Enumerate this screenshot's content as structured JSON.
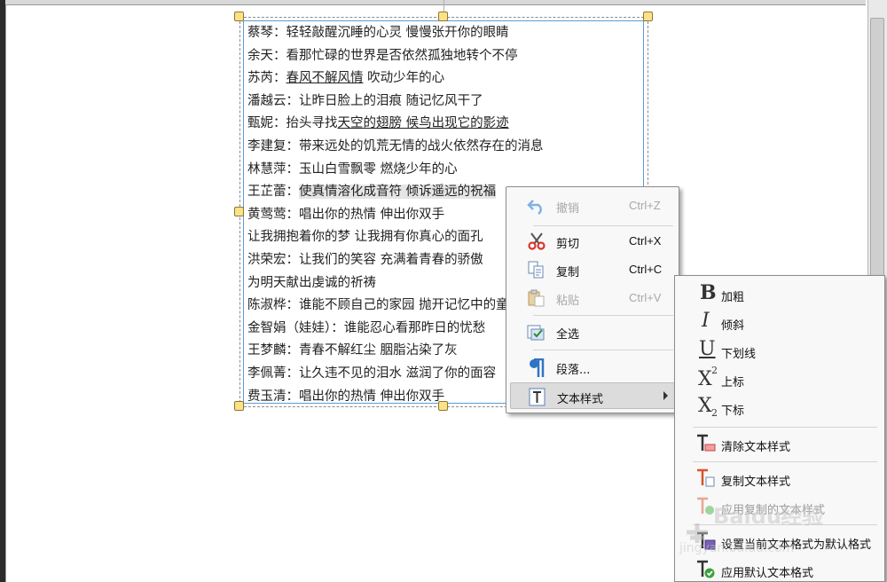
{
  "document": {
    "lines": [
      {
        "parts": [
          {
            "t": "蔡琴：轻轻敲醒沉睡的心灵 慢慢张开你的眼睛"
          }
        ]
      },
      {
        "parts": [
          {
            "t": "余天：看那忙碌的世界是否依然孤独地转个不停"
          }
        ]
      },
      {
        "parts": [
          {
            "t": "苏芮："
          },
          {
            "t": "春风不解风情",
            "u": true
          },
          {
            "t": " 吹动少年的心"
          }
        ]
      },
      {
        "parts": [
          {
            "t": "潘越云：让昨日脸上的泪痕 随记忆风干了"
          }
        ]
      },
      {
        "parts": [
          {
            "t": "甄妮：抬头寻找"
          },
          {
            "t": "天空的翅膀 候鸟出现它的影迹",
            "u": true
          }
        ]
      },
      {
        "parts": [
          {
            "t": "李建复：带来远处的饥荒无情的战火依然存在的消息"
          }
        ]
      },
      {
        "parts": [
          {
            "t": "林慧萍：玉山白雪飘零 燃烧少年的心"
          }
        ]
      },
      {
        "parts": [
          {
            "t": "王芷蕾："
          },
          {
            "t": "使真情溶化成音符 倾诉遥远的祝福",
            "hl": true
          }
        ]
      },
      {
        "parts": [
          {
            "t": "黄莺莺：唱出你的热情 伸出你双手"
          }
        ]
      },
      {
        "parts": [
          {
            "t": "让我拥抱着你的梦 让我拥有你真心的面孔"
          }
        ]
      },
      {
        "parts": [
          {
            "t": "洪荣宏：让我们的笑容 充满着青春的骄傲"
          }
        ]
      },
      {
        "parts": [
          {
            "t": "为明天献出虔诚的祈祷"
          }
        ]
      },
      {
        "parts": [
          {
            "t": "陈淑桦：谁能不顾自己的家园 抛开记忆中的童年"
          }
        ]
      },
      {
        "parts": [
          {
            "t": "金智娟（娃娃）：谁能忍心看那昨日的忧愁"
          }
        ]
      },
      {
        "parts": [
          {
            "t": "王梦麟：青春不解红尘 胭脂沾染了灰"
          }
        ]
      },
      {
        "parts": [
          {
            "t": "李佩菁：让久违不见的泪水 滋润了你的面容"
          }
        ]
      },
      {
        "parts": [
          {
            "t": "费玉清：唱出你的热情 伸出你双手"
          }
        ]
      }
    ]
  },
  "context_menu": {
    "undo": {
      "label": "撤销",
      "shortcut": "Ctrl+Z",
      "icon": "undo-icon"
    },
    "cut": {
      "label": "剪切",
      "shortcut": "Ctrl+X",
      "icon": "scissors-icon"
    },
    "copy": {
      "label": "复制",
      "shortcut": "Ctrl+C",
      "icon": "copy-icon"
    },
    "paste": {
      "label": "粘贴",
      "shortcut": "Ctrl+V",
      "icon": "paste-icon"
    },
    "select_all": {
      "label": "全选",
      "icon": "select-all-icon"
    },
    "paragraph": {
      "label": "段落...",
      "icon": "pilcrow-icon"
    },
    "text_style": {
      "label": "文本样式",
      "icon": "text-style-icon"
    }
  },
  "text_style_submenu": {
    "bold": {
      "label": "加粗",
      "glyph": "B"
    },
    "italic": {
      "label": "倾斜",
      "glyph": "I"
    },
    "underline": {
      "label": "下划线",
      "glyph": "U"
    },
    "superscript": {
      "label": "上标",
      "glyph": "X",
      "sup": "2"
    },
    "subscript": {
      "label": "下标",
      "glyph": "X",
      "sub": "2"
    },
    "clear_style": {
      "label": "清除文本样式"
    },
    "copy_style": {
      "label": "复制文本样式"
    },
    "apply_copied": {
      "label": "应用复制的文本样式"
    },
    "set_default": {
      "label": "设置当前文本格式为默认格式"
    },
    "apply_default": {
      "label": "应用默认文本格式"
    }
  },
  "watermark": {
    "brand": "Baidu",
    "cn": "经验",
    "url": "jingyan.baidu.com"
  },
  "colors": {
    "selection_border": "#5b9bd5",
    "handle": "#ffe08a",
    "menu_bg": "#f8f8f8",
    "active_item": "#dcdcdc",
    "paste_disabled": "#a8a8a8"
  }
}
